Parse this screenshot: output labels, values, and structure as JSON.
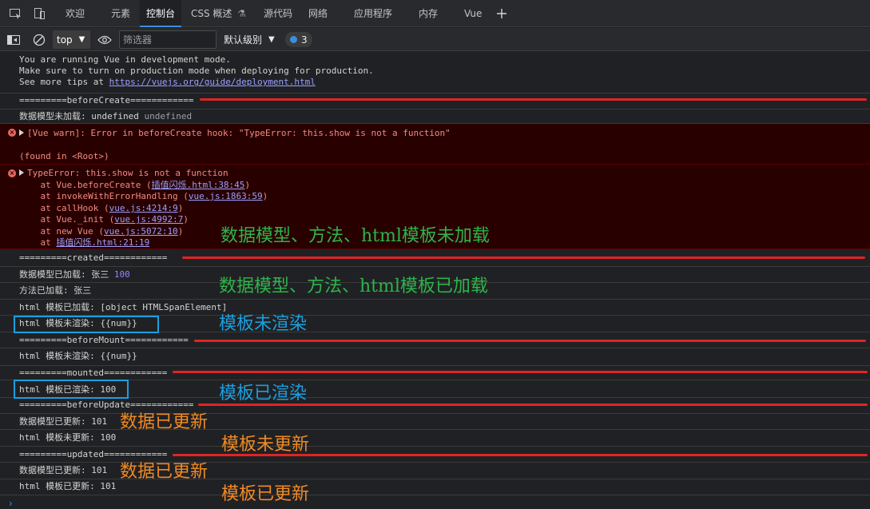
{
  "tabs": {
    "welcome": "欢迎",
    "elements": "元素",
    "console": "控制台",
    "css_overview": "CSS 概述",
    "sources": "源代码",
    "network": "网络",
    "application": "应用程序",
    "memory": "内存",
    "vue": "Vue"
  },
  "toolbar": {
    "context": "top",
    "filter_placeholder": "筛选器",
    "levels": "默认级别",
    "issues_count": "3"
  },
  "console": {
    "vue_dev_1": "You are running Vue in development mode.",
    "vue_dev_2": "Make sure to turn on production mode when deploying for production.",
    "vue_dev_3_prefix": "See more tips at ",
    "vue_dev_3_link": "https://vuejs.org/guide/deployment.html",
    "before_create": "=========beforeCreate============",
    "data_not_loaded_prefix": "数据模型未加载: undefined ",
    "data_not_loaded_grey": "undefined",
    "warn_line": "[Vue warn]: Error in beforeCreate hook: \"TypeError: this.show is not a function\"",
    "found_in": "(found in <Root>)",
    "type_error": "TypeError: this.show is not a function",
    "stack": [
      {
        "prefix": "    at Vue.beforeCreate (",
        "link": "插值闪烁.html:38:45",
        "suffix": ")"
      },
      {
        "prefix": "    at invokeWithErrorHandling (",
        "link": "vue.js:1863:59",
        "suffix": ")"
      },
      {
        "prefix": "    at callHook (",
        "link": "vue.js:4214:9",
        "suffix": ")"
      },
      {
        "prefix": "    at Vue._init (",
        "link": "vue.js:4992:7",
        "suffix": ")"
      },
      {
        "prefix": "    at new Vue (",
        "link": "vue.js:5072:10",
        "suffix": ")"
      },
      {
        "prefix": "    at ",
        "link": "插值闪烁.html:21:19",
        "suffix": ""
      }
    ],
    "created": "=========created============",
    "data_loaded_prefix": "数据模型已加载: 张三 ",
    "data_loaded_num": "100",
    "method_loaded": "方法已加载: 张三",
    "html_loaded": "html 模板已加载: [object HTMLSpanElement]",
    "html_not_rendered_1": "html 模板未渲染: {{num}}",
    "before_mount": "=========beforeMount============",
    "html_not_rendered_2": "html 模板未渲染: {{num}}",
    "mounted": "=========mounted============",
    "html_rendered": "html 模板已渲染: 100",
    "before_update": "=========beforeUpdate============",
    "data_updated_1": "数据模型已更新: 101",
    "html_not_updated": "html 模板未更新: 100",
    "updated": "=========updated============",
    "data_updated_2": "数据模型已更新: 101",
    "html_updated": "html 模板已更新: 101"
  },
  "annotations": {
    "not_loaded": "数据模型、方法、html模板未加载",
    "loaded": "数据模型、方法、html模板已加载",
    "tpl_not_rendered": "模板未渲染",
    "tpl_rendered": "模板已渲染",
    "data_updated_a": "数据已更新",
    "tpl_not_updated": "模板未更新",
    "data_updated_b": "数据已更新",
    "tpl_updated": "模板已更新"
  },
  "colors": {
    "annotation_green": "#2eb44a",
    "annotation_blue": "#1b9fe0",
    "annotation_orange": "#f08a24",
    "marker_red": "#e02424"
  }
}
